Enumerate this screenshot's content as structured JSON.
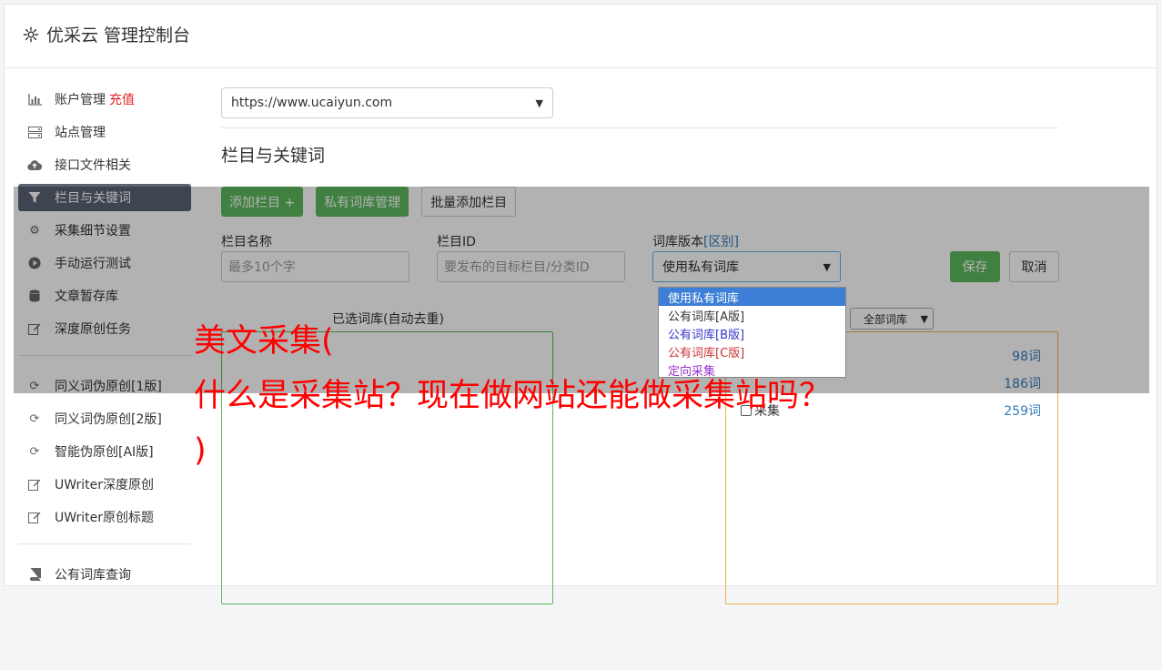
{
  "header": {
    "title": "优采云 管理控制台",
    "icon": "gear-icon"
  },
  "sidebar": {
    "group1": [
      {
        "label": "账户管理",
        "extra": "充值",
        "icon": "bar-chart-icon"
      },
      {
        "label": "站点管理",
        "icon": "server-icon"
      },
      {
        "label": "接口文件相关",
        "icon": "cloud-upload-icon"
      },
      {
        "label": "栏目与关键词",
        "icon": "filter-icon",
        "active": true
      },
      {
        "label": "采集细节设置",
        "icon": "cogs-icon"
      },
      {
        "label": "手动运行测试",
        "icon": "play-circle-icon"
      },
      {
        "label": "文章暂存库",
        "icon": "database-icon"
      },
      {
        "label": "深度原创任务",
        "icon": "edit-icon"
      }
    ],
    "group2": [
      {
        "label": "同义词伪原创[1版]",
        "icon": "refresh-icon"
      },
      {
        "label": "同义词伪原创[2版]",
        "icon": "refresh-icon"
      },
      {
        "label": "智能伪原创[AI版]",
        "icon": "refresh-icon"
      },
      {
        "label": "UWriter深度原创",
        "icon": "edit-icon"
      },
      {
        "label": "UWriter原创标题",
        "icon": "edit-icon"
      }
    ],
    "group3": [
      {
        "label": "公有词库查询",
        "icon": "book-icon"
      }
    ]
  },
  "main": {
    "site_select": "https://www.ucaiyun.com",
    "section_title": "栏目与关键词",
    "buttons": {
      "add_column": "添加栏目 +",
      "private_lib": "私有词库管理",
      "batch_add": "批量添加栏目"
    },
    "form": {
      "column_name_label": "栏目名称",
      "column_name_placeholder": "最多10个字",
      "column_id_label": "栏目ID",
      "column_id_placeholder": "要发布的目标栏目/分类ID",
      "lib_version_label": "词库版本",
      "lib_version_link": "[区别]",
      "lib_version_value": "使用私有词库",
      "save": "保存",
      "cancel": "取消"
    },
    "dropdown_options": [
      {
        "label": "使用私有词库",
        "color": "#ffffff",
        "selected": true
      },
      {
        "label": "公有词库[A版]",
        "color": "#333333"
      },
      {
        "label": "公有词库[B版]",
        "color": "#3333cc"
      },
      {
        "label": "公有词库[C版]",
        "color": "#cc3333"
      },
      {
        "label": "定向采集",
        "color": "#9933cc"
      }
    ],
    "selected_lib_label": "已选词库(自动去重)",
    "filter_select": "全部词库",
    "libraries": [
      {
        "name": "",
        "count": "98词"
      },
      {
        "name": "",
        "count": "186词"
      },
      {
        "name": "采集",
        "count": "259词"
      }
    ]
  },
  "overlay_text": {
    "line1": "美文采集(",
    "line2": "什么是采集站？现在做网站还能做采集站吗？",
    "line3": ")"
  }
}
